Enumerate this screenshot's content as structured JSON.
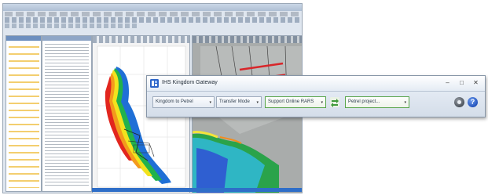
{
  "gateway": {
    "title": "IHS Kingdom Gateway",
    "window_controls": {
      "minimize": "–",
      "maximize": "□",
      "close": "✕"
    },
    "combos": [
      {
        "label": "Kingdom to Petrel",
        "arrow": "▾"
      },
      {
        "label": "Transfer Mode",
        "arrow": "▾"
      },
      {
        "label": "Support Online RARS",
        "arrow": "▾"
      },
      {
        "label": "Petrel project...",
        "arrow": "▾"
      }
    ],
    "help_label": "?"
  },
  "colors": {
    "accent_green": "#58a54b",
    "title_icon_blue": "#2c64c8",
    "help_blue": "#1f4fb8"
  },
  "icons": [
    "ihs-logo-icon",
    "swap-arrows-icon",
    "gear-icon",
    "help-icon"
  ]
}
